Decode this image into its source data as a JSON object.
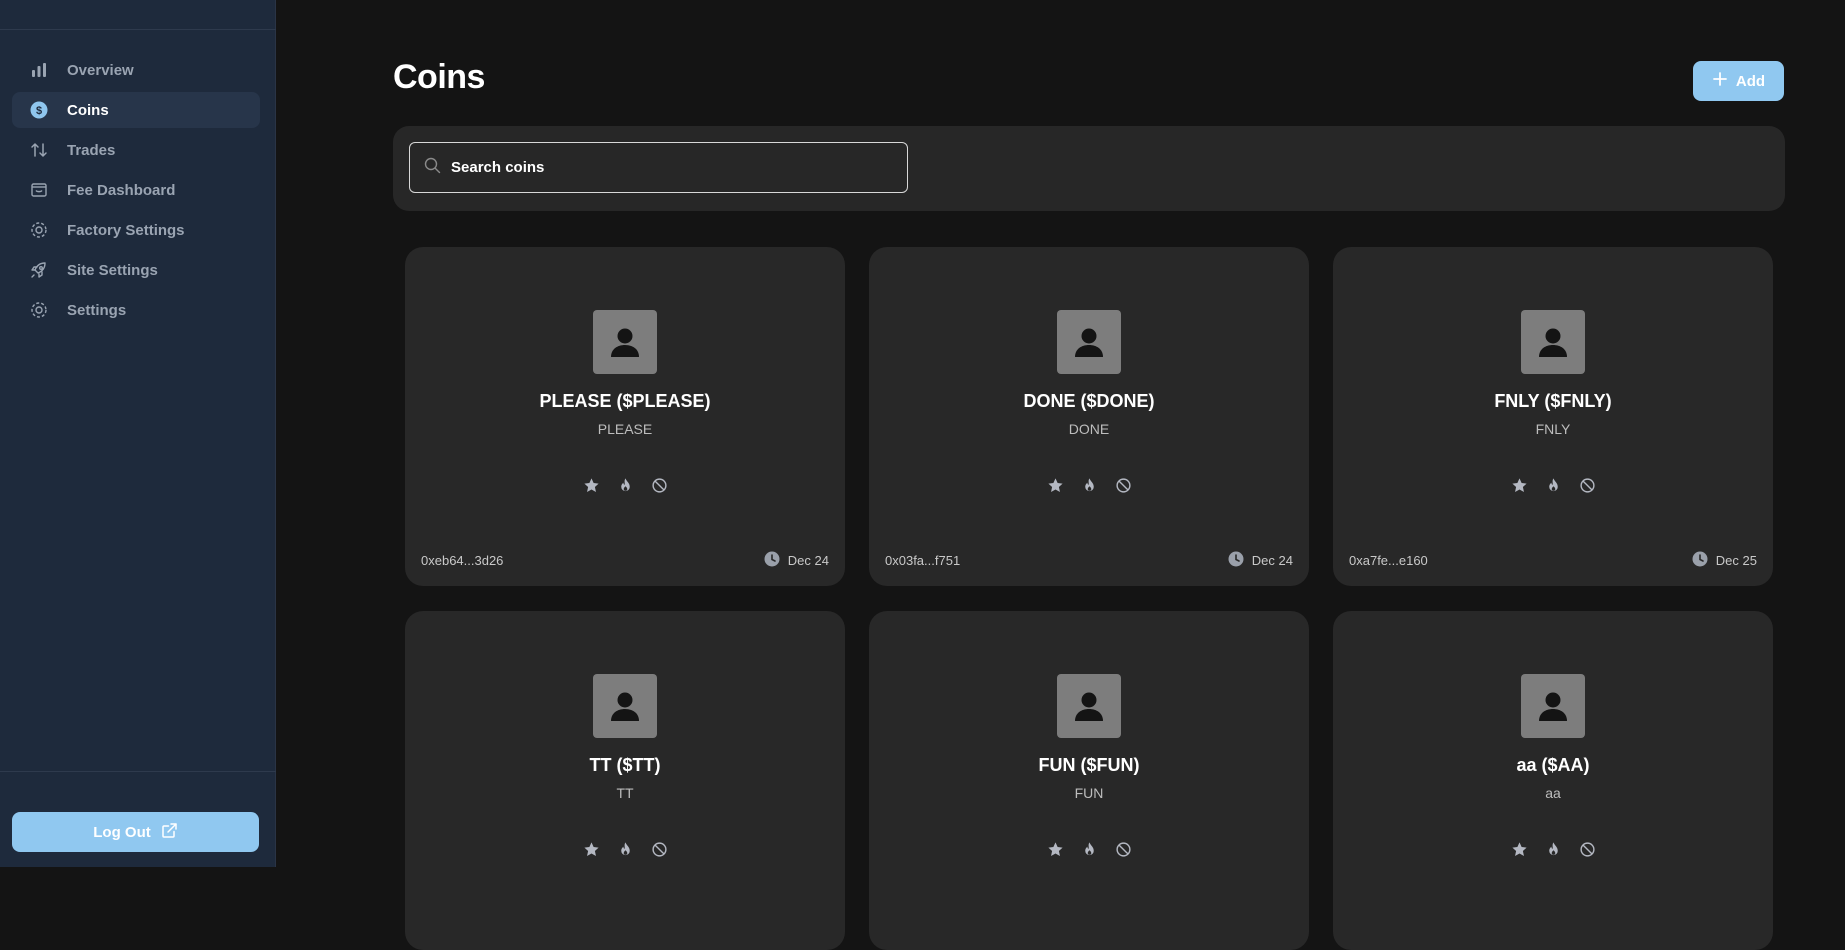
{
  "sidebar": {
    "items": [
      {
        "label": "Overview",
        "icon": "bar-chart-icon",
        "active": false
      },
      {
        "label": "Coins",
        "icon": "dollar-circle-icon",
        "active": true
      },
      {
        "label": "Trades",
        "icon": "arrows-up-down-icon",
        "active": false
      },
      {
        "label": "Fee Dashboard",
        "icon": "inbox-icon",
        "active": false
      },
      {
        "label": "Factory Settings",
        "icon": "gear-icon",
        "active": false
      },
      {
        "label": "Site Settings",
        "icon": "rocket-icon",
        "active": false
      },
      {
        "label": "Settings",
        "icon": "gear-icon",
        "active": false
      }
    ],
    "logout_label": "Log Out"
  },
  "header": {
    "title": "Coins",
    "add_label": "Add"
  },
  "search": {
    "placeholder": "Search coins"
  },
  "colors": {
    "accent": "#90c8f0",
    "sidebar_bg": "#1e2a3c",
    "page_bg": "#141414",
    "card_bg": "#282828"
  },
  "coins": [
    {
      "title": "PLEASE ($PLEASE)",
      "name": "PLEASE",
      "address": "0xeb64...3d26",
      "date": "Dec 24"
    },
    {
      "title": "DONE ($DONE)",
      "name": "DONE",
      "address": "0x03fa...f751",
      "date": "Dec 24"
    },
    {
      "title": "FNLY ($FNLY)",
      "name": "FNLY",
      "address": "0xa7fe...e160",
      "date": "Dec 25"
    },
    {
      "title": "TT ($TT)",
      "name": "TT",
      "address": "",
      "date": ""
    },
    {
      "title": "FUN ($FUN)",
      "name": "FUN",
      "address": "",
      "date": ""
    },
    {
      "title": "aa ($AA)",
      "name": "aa",
      "address": "",
      "date": ""
    }
  ]
}
